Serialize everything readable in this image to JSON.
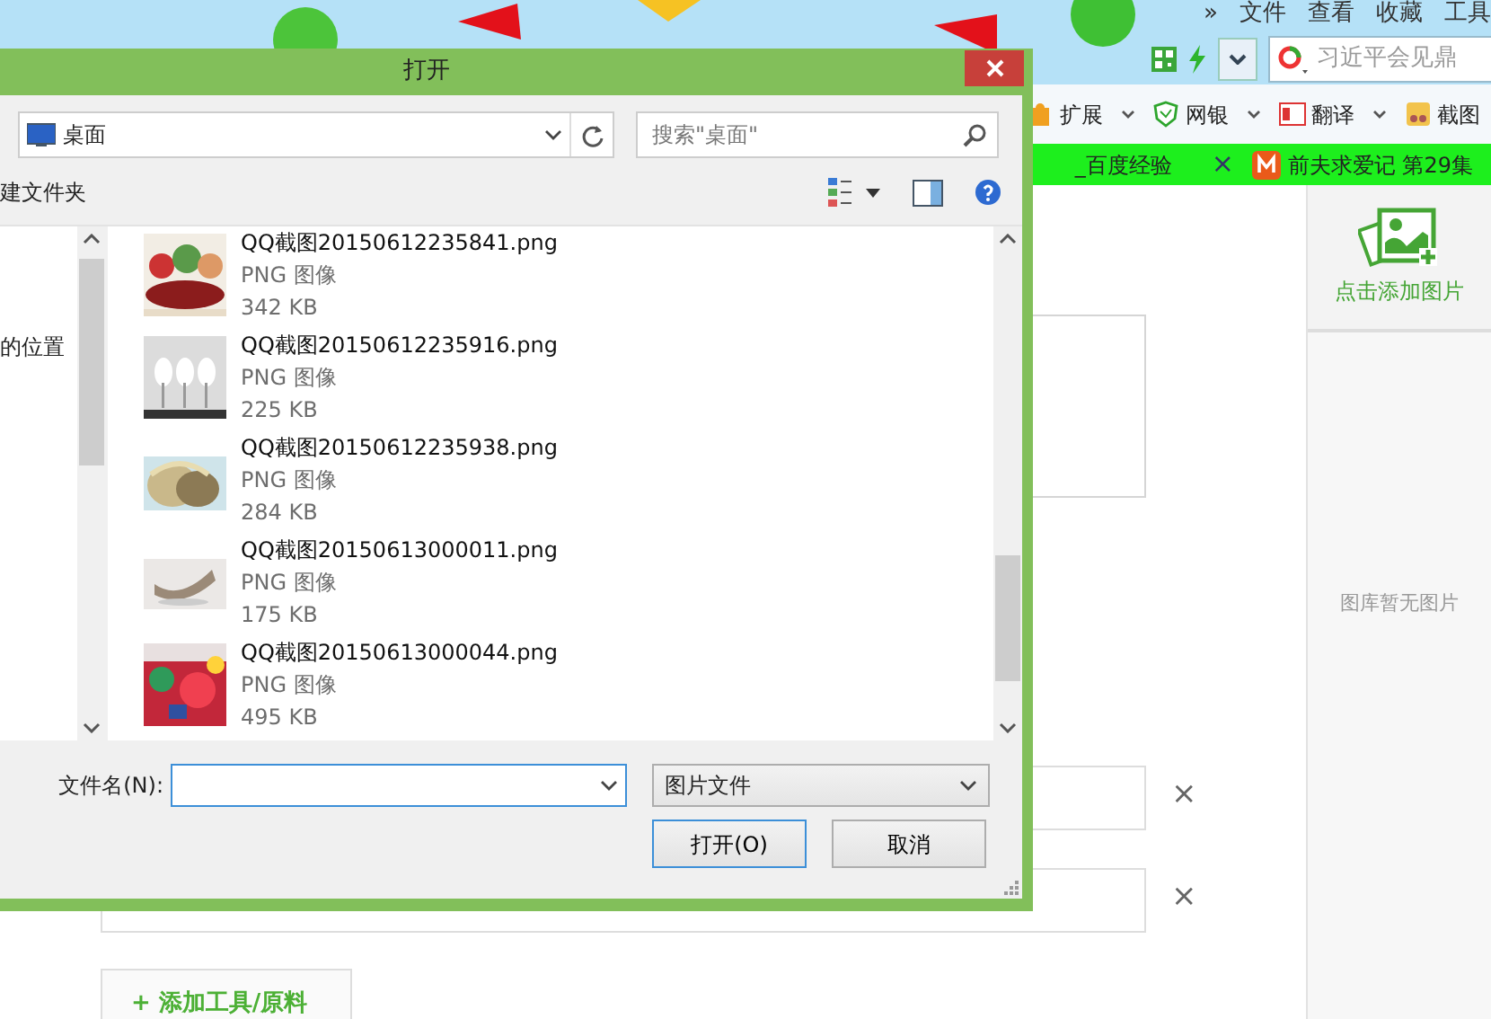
{
  "browser": {
    "menu": [
      "»",
      "文件",
      "查看",
      "收藏",
      "工具"
    ],
    "search": {
      "placeholder": "习近平会见鼎"
    },
    "toolbar": [
      {
        "label": "扩展",
        "dropdown": true
      },
      {
        "label": "网银",
        "dropdown": true
      },
      {
        "label": "翻译",
        "dropdown": true
      },
      {
        "label": "截图",
        "dropdown": false
      }
    ],
    "tabs": [
      {
        "label": "_百度经验",
        "closable": true,
        "close": "×"
      },
      {
        "label": "前夫求爱记 第29集",
        "closable": false
      }
    ]
  },
  "page": {
    "sidebar": {
      "add_label": "点击添加图片",
      "empty_text": "图库暂无图片"
    },
    "rows": [
      {
        "remove": "×"
      },
      {
        "remove": "×"
      }
    ],
    "add_button": "+ 添加工具/原料"
  },
  "dialog": {
    "title": "打开",
    "location": "桌面",
    "search": {
      "placeholder": "搜索\"桌面\""
    },
    "new_folder": "建文件夹",
    "nav_item": "的位置",
    "files": [
      {
        "name": "QQ截图20150612235841.png",
        "type": "PNG 图像",
        "size": "342 KB"
      },
      {
        "name": "QQ截图20150612235916.png",
        "type": "PNG 图像",
        "size": "225 KB"
      },
      {
        "name": "QQ截图20150612235938.png",
        "type": "PNG 图像",
        "size": "284 KB"
      },
      {
        "name": "QQ截图20150613000011.png",
        "type": "PNG 图像",
        "size": "175 KB"
      },
      {
        "name": "QQ截图20150613000044.png",
        "type": "PNG 图像",
        "size": "495 KB"
      }
    ],
    "filename_label": "文件名(N):",
    "filter": "图片文件",
    "buttons": [
      {
        "label": "打开(O)",
        "default": true
      },
      {
        "label": "取消",
        "default": false
      }
    ]
  }
}
